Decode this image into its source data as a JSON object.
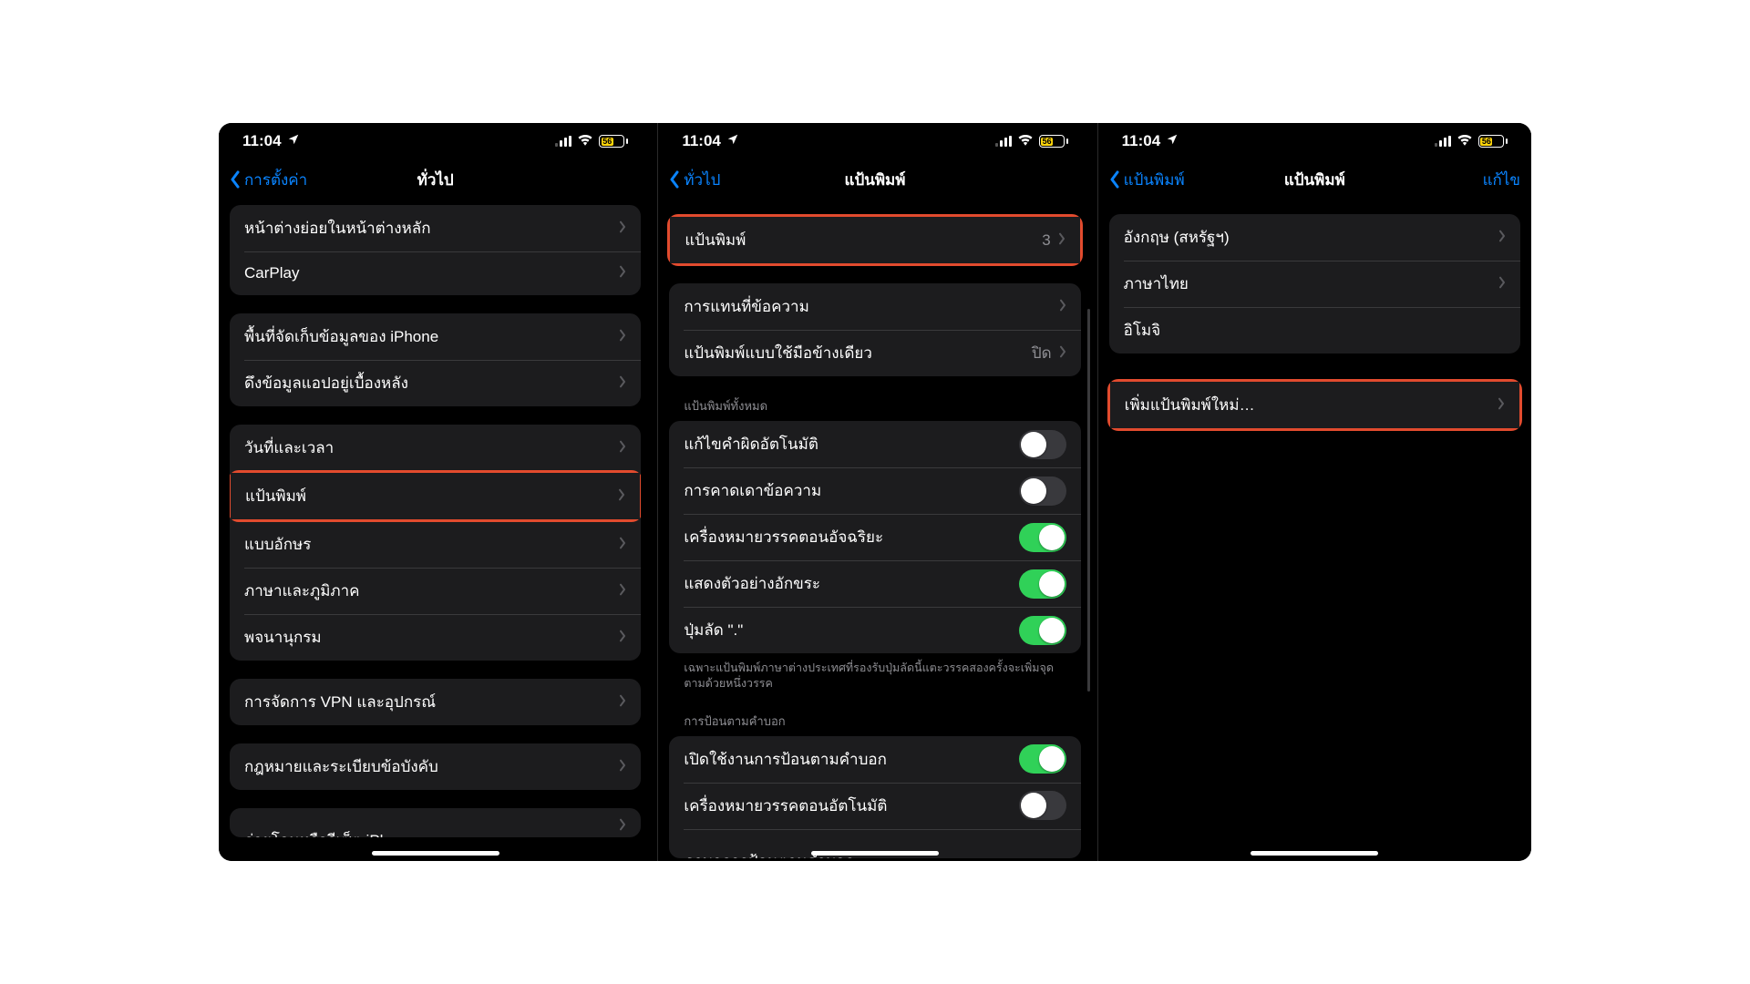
{
  "status": {
    "time": "11:04",
    "battery_pct": "56"
  },
  "phone1": {
    "back": "การตั้งค่า",
    "title": "ทั่วไป",
    "rows": {
      "pip": "หน้าต่างย่อยในหน้าต่างหลัก",
      "carplay": "CarPlay",
      "storage": "พื้นที่จัดเก็บข้อมูลของ iPhone",
      "bgrefresh": "ดึงข้อมูลแอปอยู่เบื้องหลัง",
      "datetime": "วันที่และเวลา",
      "keyboard": "แป้นพิมพ์",
      "fonts": "แบบอักษร",
      "langregion": "ภาษาและภูมิภาค",
      "dictionary": "พจนานุกรม",
      "vpn": "การจัดการ VPN และอุปกรณ์",
      "legal": "กฎหมายและระเบียบข้อบังคับ",
      "transfer": "ถ่ายโอนหรือรีเซ็ต iPhone"
    }
  },
  "phone2": {
    "back": "ทั่วไป",
    "title": "แป้นพิมพ์",
    "keyboards_label": "แป้นพิมพ์",
    "keyboards_count": "3",
    "textreplace": "การแทนที่ข้อความ",
    "onehand": "แป้นพิมพ์แบบใช้มือข้างเดียว",
    "onehand_value": "ปิด",
    "allkeyboards_header": "แป้นพิมพ์ทั้งหมด",
    "toggles": {
      "autocorrect": "แก้ไขคำผิดอัตโนมัติ",
      "predictive": "การคาดเดาข้อความ",
      "smartpunct": "เครื่องหมายวรรคตอนอัจฉริยะ",
      "charpreview": "แสดงตัวอย่างอักขระ",
      "shortcut": "ปุ่มลัด \".\""
    },
    "footnote": "เฉพาะแป้นพิมพ์ภาษาต่างประเทศที่รองรับปุ่มลัดนี้แตะวรรคสองครั้งจะเพิ่มจุดตามด้วยหนึ่งวรรค",
    "dictation_header": "การป้อนตามคำบอก",
    "dictation_enable": "เปิดใช้งานการป้อนตามคำบอก",
    "dictation_autopunct": "เครื่องหมายวรรคตอนอัตโนมัติ",
    "dictation_lang": "ภาษาการป้อนตามคำบอก"
  },
  "phone3": {
    "back": "แป้นพิมพ์",
    "title": "แป้นพิมพ์",
    "edit": "แก้ไข",
    "items": {
      "en": "อังกฤษ (สหรัฐฯ)",
      "th": "ภาษาไทย",
      "emoji": "อิโมจิ"
    },
    "addnew": "เพิ่มแป้นพิมพ์ใหม่…"
  }
}
